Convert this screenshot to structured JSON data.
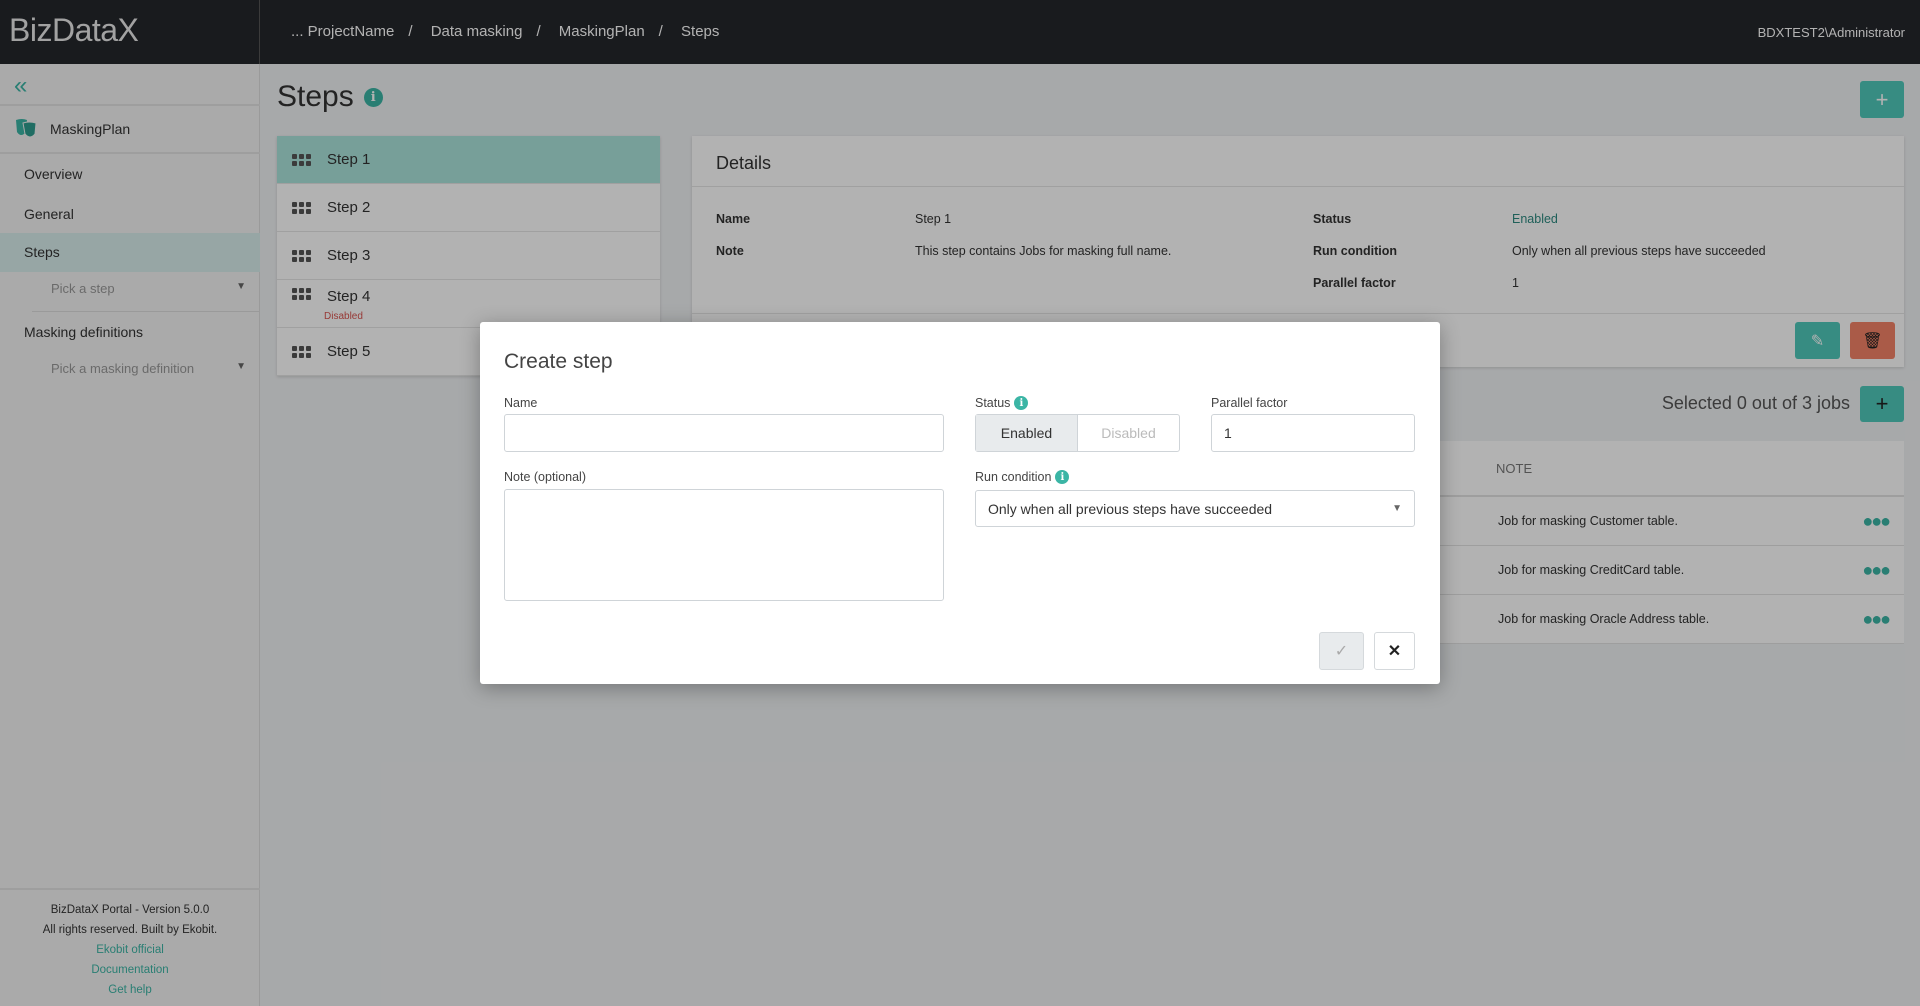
{
  "header": {
    "logo": "BizDataX",
    "breadcrumbs": [
      "... ProjectName",
      "Data masking",
      "MaskingPlan",
      "Steps"
    ],
    "user": "BDXTEST2\\Administrator"
  },
  "sidebar": {
    "plan": "MaskingPlan",
    "items": [
      {
        "label": "Overview"
      },
      {
        "label": "General"
      },
      {
        "label": "Steps"
      },
      {
        "label": "Masking definitions"
      }
    ],
    "pick_step": "Pick a step",
    "pick_def": "Pick a masking definition",
    "footer": {
      "version": "BizDataX Portal - Version 5.0.0",
      "rights": "All rights reserved. Built by Ekobit.",
      "links": [
        "Ekobit official",
        "Documentation",
        "Get help"
      ]
    }
  },
  "page": {
    "title": "Steps"
  },
  "steps": [
    {
      "label": "Step 1"
    },
    {
      "label": "Step 2"
    },
    {
      "label": "Step 3"
    },
    {
      "label": "Step 4",
      "badge": "Disabled"
    },
    {
      "label": "Step 5"
    }
  ],
  "details": {
    "title": "Details",
    "name_label": "Name",
    "name": "Step 1",
    "note_label": "Note",
    "note": "This step contains Jobs for masking full name.",
    "status_label": "Status",
    "status": "Enabled",
    "run_label": "Run condition",
    "run": "Only when all previous steps have succeeded",
    "pf_label": "Parallel factor",
    "pf": "1"
  },
  "jobs": {
    "selected": "Selected 0 out of 3 jobs",
    "note_header": "NOTE",
    "rows": [
      "Job for masking Customer table.",
      "Job for masking CreditCard table.",
      "Job for masking Oracle Address table."
    ]
  },
  "modal": {
    "title": "Create step",
    "name_label": "Name",
    "name_value": "",
    "status_label": "Status",
    "enabled": "Enabled",
    "disabled": "Disabled",
    "pf_label": "Parallel factor",
    "pf_value": "1",
    "note_label": "Note (optional)",
    "run_label": "Run condition",
    "run_value": "Only when all previous steps have succeeded"
  },
  "colors": {
    "accent": "#4fc9bb",
    "danger": "#f48367",
    "header": "#25272c"
  }
}
